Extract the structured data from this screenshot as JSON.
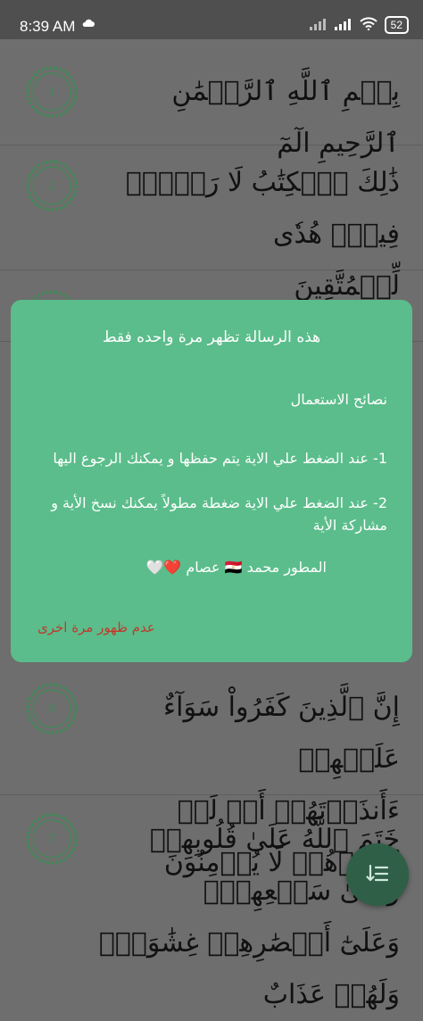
{
  "status_bar": {
    "time": "8:39 AM",
    "battery": "52",
    "icons": [
      "cloud-icon",
      "signal-icon",
      "signal-icon",
      "wifi-icon",
      "battery-icon"
    ]
  },
  "verses": [
    {
      "number": "1",
      "lines": [
        "بِسۡمِ ٱللَّهِ ٱلرَّحۡمَٰنِ ٱلرَّحِيمِ الٓمٓ"
      ]
    },
    {
      "number": "2",
      "lines": [
        "ذَٰلِكَ ٱلۡكِتَٰبُ لَا رَيۡبَۛ فِيهِۛ هُدٗى",
        "لِّلۡمُتَّقِينَ"
      ]
    },
    {
      "number": "6",
      "lines": [
        "إِنَّ ٱلَّذِينَ كَفَرُواْ سَوَآءٌ عَلَيۡهِمۡ",
        "ءَأَنذَرۡتَهُمۡ أَمۡ لَمۡ تُنذِرۡهُمۡ لَا يُؤۡمِنُونَ"
      ]
    },
    {
      "number": "7",
      "lines": [
        "خَتَمَ ٱللَّهُ عَلَىٰ قُلُوبِهِمۡ وَعَلَىٰ سَمۡعِهِمۡۖ",
        "وَعَلَىٰٓ أَبۡصَٰرِهِمۡ غِشَٰوَةٞۖ وَلَهُمۡ عَذَابٌ"
      ]
    }
  ],
  "dialog": {
    "title": "هذه الرسالة تظهر مرة واحده فقط",
    "tips_heading": "نصائح الاستعمال",
    "tip_1": "1- عند الضغط علي الاية يتم حفظها و يمكنك الرجوع اليها",
    "tip_2_line_1": "2- عند الضغط علي الاية ضغطة مطولاً يمكنك نسخ الأية و",
    "tip_2_line_2": "مشاركة الأية",
    "developer": "المطور محمد 🇪🇬 عصام ❤️🤍",
    "dismiss": "عدم ظهور مرة اخرى"
  },
  "fab": {
    "icon": "sort-list-icon"
  },
  "colors": {
    "dialog_bg": "#5bbd8b",
    "dismiss_text": "#c0392b",
    "verse_badge": "#3e8a55",
    "fab_bg": "#2f5f47",
    "overlay_bg": "#6e6e6e"
  }
}
